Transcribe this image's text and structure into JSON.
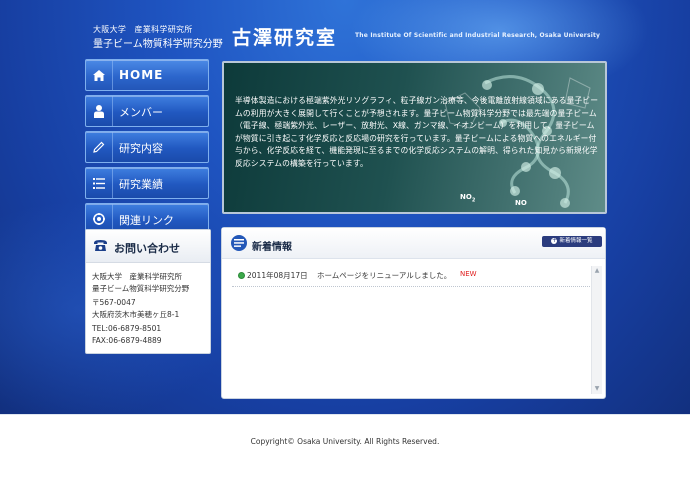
{
  "header": {
    "university": "大阪大学　産業科学研究所",
    "division": "量子ビーム物質科学研究分野",
    "lab_name": "古澤研究室",
    "english_name": "The Institute Of Scientific and Industrial Research, Osaka University"
  },
  "nav": {
    "items": [
      {
        "label": "HOME",
        "icon": "home-icon"
      },
      {
        "label": "メンバー",
        "icon": "person-icon"
      },
      {
        "label": "研究内容",
        "icon": "pencil-icon"
      },
      {
        "label": "研究業績",
        "icon": "list-icon"
      },
      {
        "label": "関連リンク",
        "icon": "link-icon"
      }
    ]
  },
  "contact": {
    "title": "お問い合わせ",
    "org1": "大阪大学　産業科学研究所",
    "org2": "量子ビーム物質科学研究分野",
    "postal": "〒567-0047",
    "address": "大阪府茨木市美穂ヶ丘8-1",
    "tel": "TEL:06-6879-8501",
    "fax": "FAX:06-6879-4889"
  },
  "hero": {
    "text": "半導体製造における極端紫外光リソグラフィ、粒子線ガン治療等、今後電離放射線領域にある量子ビームの利用が大きく展開して行くことが予想されます。量子ビーム物質科学分野では最先端の量子ビーム（電子線、極端紫外光、レーザー、放射光、X線、ガンマ線、イオンビーム）を利用して、量子ビームが物質に引き起こす化学反応と反応場の研究を行っています。量子ビームによる物質へのエネルギー付与から、化学反応を経て、機能発現に至るまでの化学反応システムの解明、得られた知見から新規化学反応システムの構築を行っています。",
    "label_no2": "NO",
    "label_no2_sub": "2",
    "label_no": "NO"
  },
  "news": {
    "title": "新着情報",
    "all_button": "新着情報一覧",
    "items": [
      {
        "date": "2011年08月17日",
        "text": "ホームページをリニューアルしました。",
        "badge": "NEW"
      }
    ]
  },
  "footer": {
    "copyright": "Copyright© Osaka University. All Rights Reserved."
  }
}
